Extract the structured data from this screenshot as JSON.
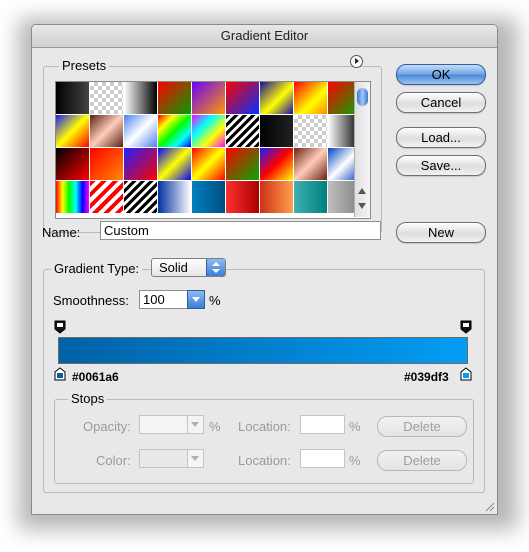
{
  "window": {
    "title": "Gradient Editor"
  },
  "presets": {
    "label": "Presets",
    "swatches": [
      "linear-gradient(90deg,#000,#444)",
      "repeating-conic-gradient(#ccc 0 25%,#fff 0 50%) 0 0/8px 8px",
      "linear-gradient(90deg,#fff,#000)",
      "linear-gradient(135deg,#ff0000,#00a000)",
      "linear-gradient(135deg,#6a00ff,#ff9a00)",
      "linear-gradient(135deg,#ff0000,#0030ff)",
      "linear-gradient(135deg,#1a0aa0,#ffff00 55%,#1a0aa0)",
      "linear-gradient(135deg,#ff0000,#ffff00 60%,#ff8800)",
      "linear-gradient(135deg,#ff0000,#00aa00)",
      "linear-gradient(135deg,#1a1aff,#ffff00,#ff0000)",
      "linear-gradient(135deg,#5a2010,#ffcdbb,#5a2010)",
      "linear-gradient(135deg,#4a80f0,#ffffff,#4a80f0)",
      "linear-gradient(135deg,#ff0000,#ffff00,#00ff00,#00ffff,#0000ff)",
      "linear-gradient(135deg,#ff00ff,#00ffff,#ffff00,#ff00ff)",
      "repeating-linear-gradient(135deg,#000 0 3px,#fff 3px 6px)",
      "linear-gradient(90deg,#000,#222)",
      "repeating-conic-gradient(#ccc 0 25%,#fff 0 50%) 0 0/8px 8px",
      "linear-gradient(90deg,#fff,#000)",
      "linear-gradient(135deg,#000,#ff0000)",
      "linear-gradient(135deg,#ff0000,#ff8800)",
      "linear-gradient(135deg,#2020ff,#ff0000)",
      "linear-gradient(135deg,#0000ff,#ffff00,#0000ff)",
      "linear-gradient(135deg,#ff0000,#ffff00,#ff0000)",
      "linear-gradient(135deg,#ff0000,#00aa00)",
      "linear-gradient(135deg,#1a1aff,#ff0000,#ffff00)",
      "linear-gradient(135deg,#6a2010,#ffcdbb,#6a2010)",
      "linear-gradient(135deg,#0040c0,#ffffff,#0040c0)",
      "linear-gradient(90deg,#ff0000,#ffff00,#00ff00,#00ffff,#0000ff,#ff00ff)",
      "repeating-linear-gradient(135deg,#ff0000 0 4px,#ffffff 4px 8px)",
      "repeating-linear-gradient(135deg,#000 0 3px,#fff 3px 6px)",
      "linear-gradient(90deg,#0030a0,#ffffff)",
      "linear-gradient(90deg,#0080c0,#005080)",
      "linear-gradient(90deg,#ff3030,#aa0000)",
      "linear-gradient(90deg,#cc3010,#ffa050)",
      "linear-gradient(90deg,#40b0b0,#008080)",
      "linear-gradient(90deg,#c0c0c0,#808080)"
    ]
  },
  "buttons": {
    "ok": "OK",
    "cancel": "Cancel",
    "load": "Load...",
    "save": "Save...",
    "new": "New"
  },
  "name": {
    "label": "Name:",
    "value": "Custom"
  },
  "gradient_type": {
    "label": "Gradient Type:",
    "value": "Solid"
  },
  "smoothness": {
    "label": "Smoothness:",
    "value": "100",
    "unit": "%"
  },
  "gradient": {
    "start_color": "#0061a6",
    "end_color": "#039df3",
    "start_label": "#0061a6",
    "end_label": "#039df3"
  },
  "stops": {
    "label": "Stops",
    "opacity_label": "Opacity:",
    "opacity_unit": "%",
    "location_label": "Location:",
    "location_unit": "%",
    "color_label": "Color:",
    "delete_label": "Delete"
  }
}
